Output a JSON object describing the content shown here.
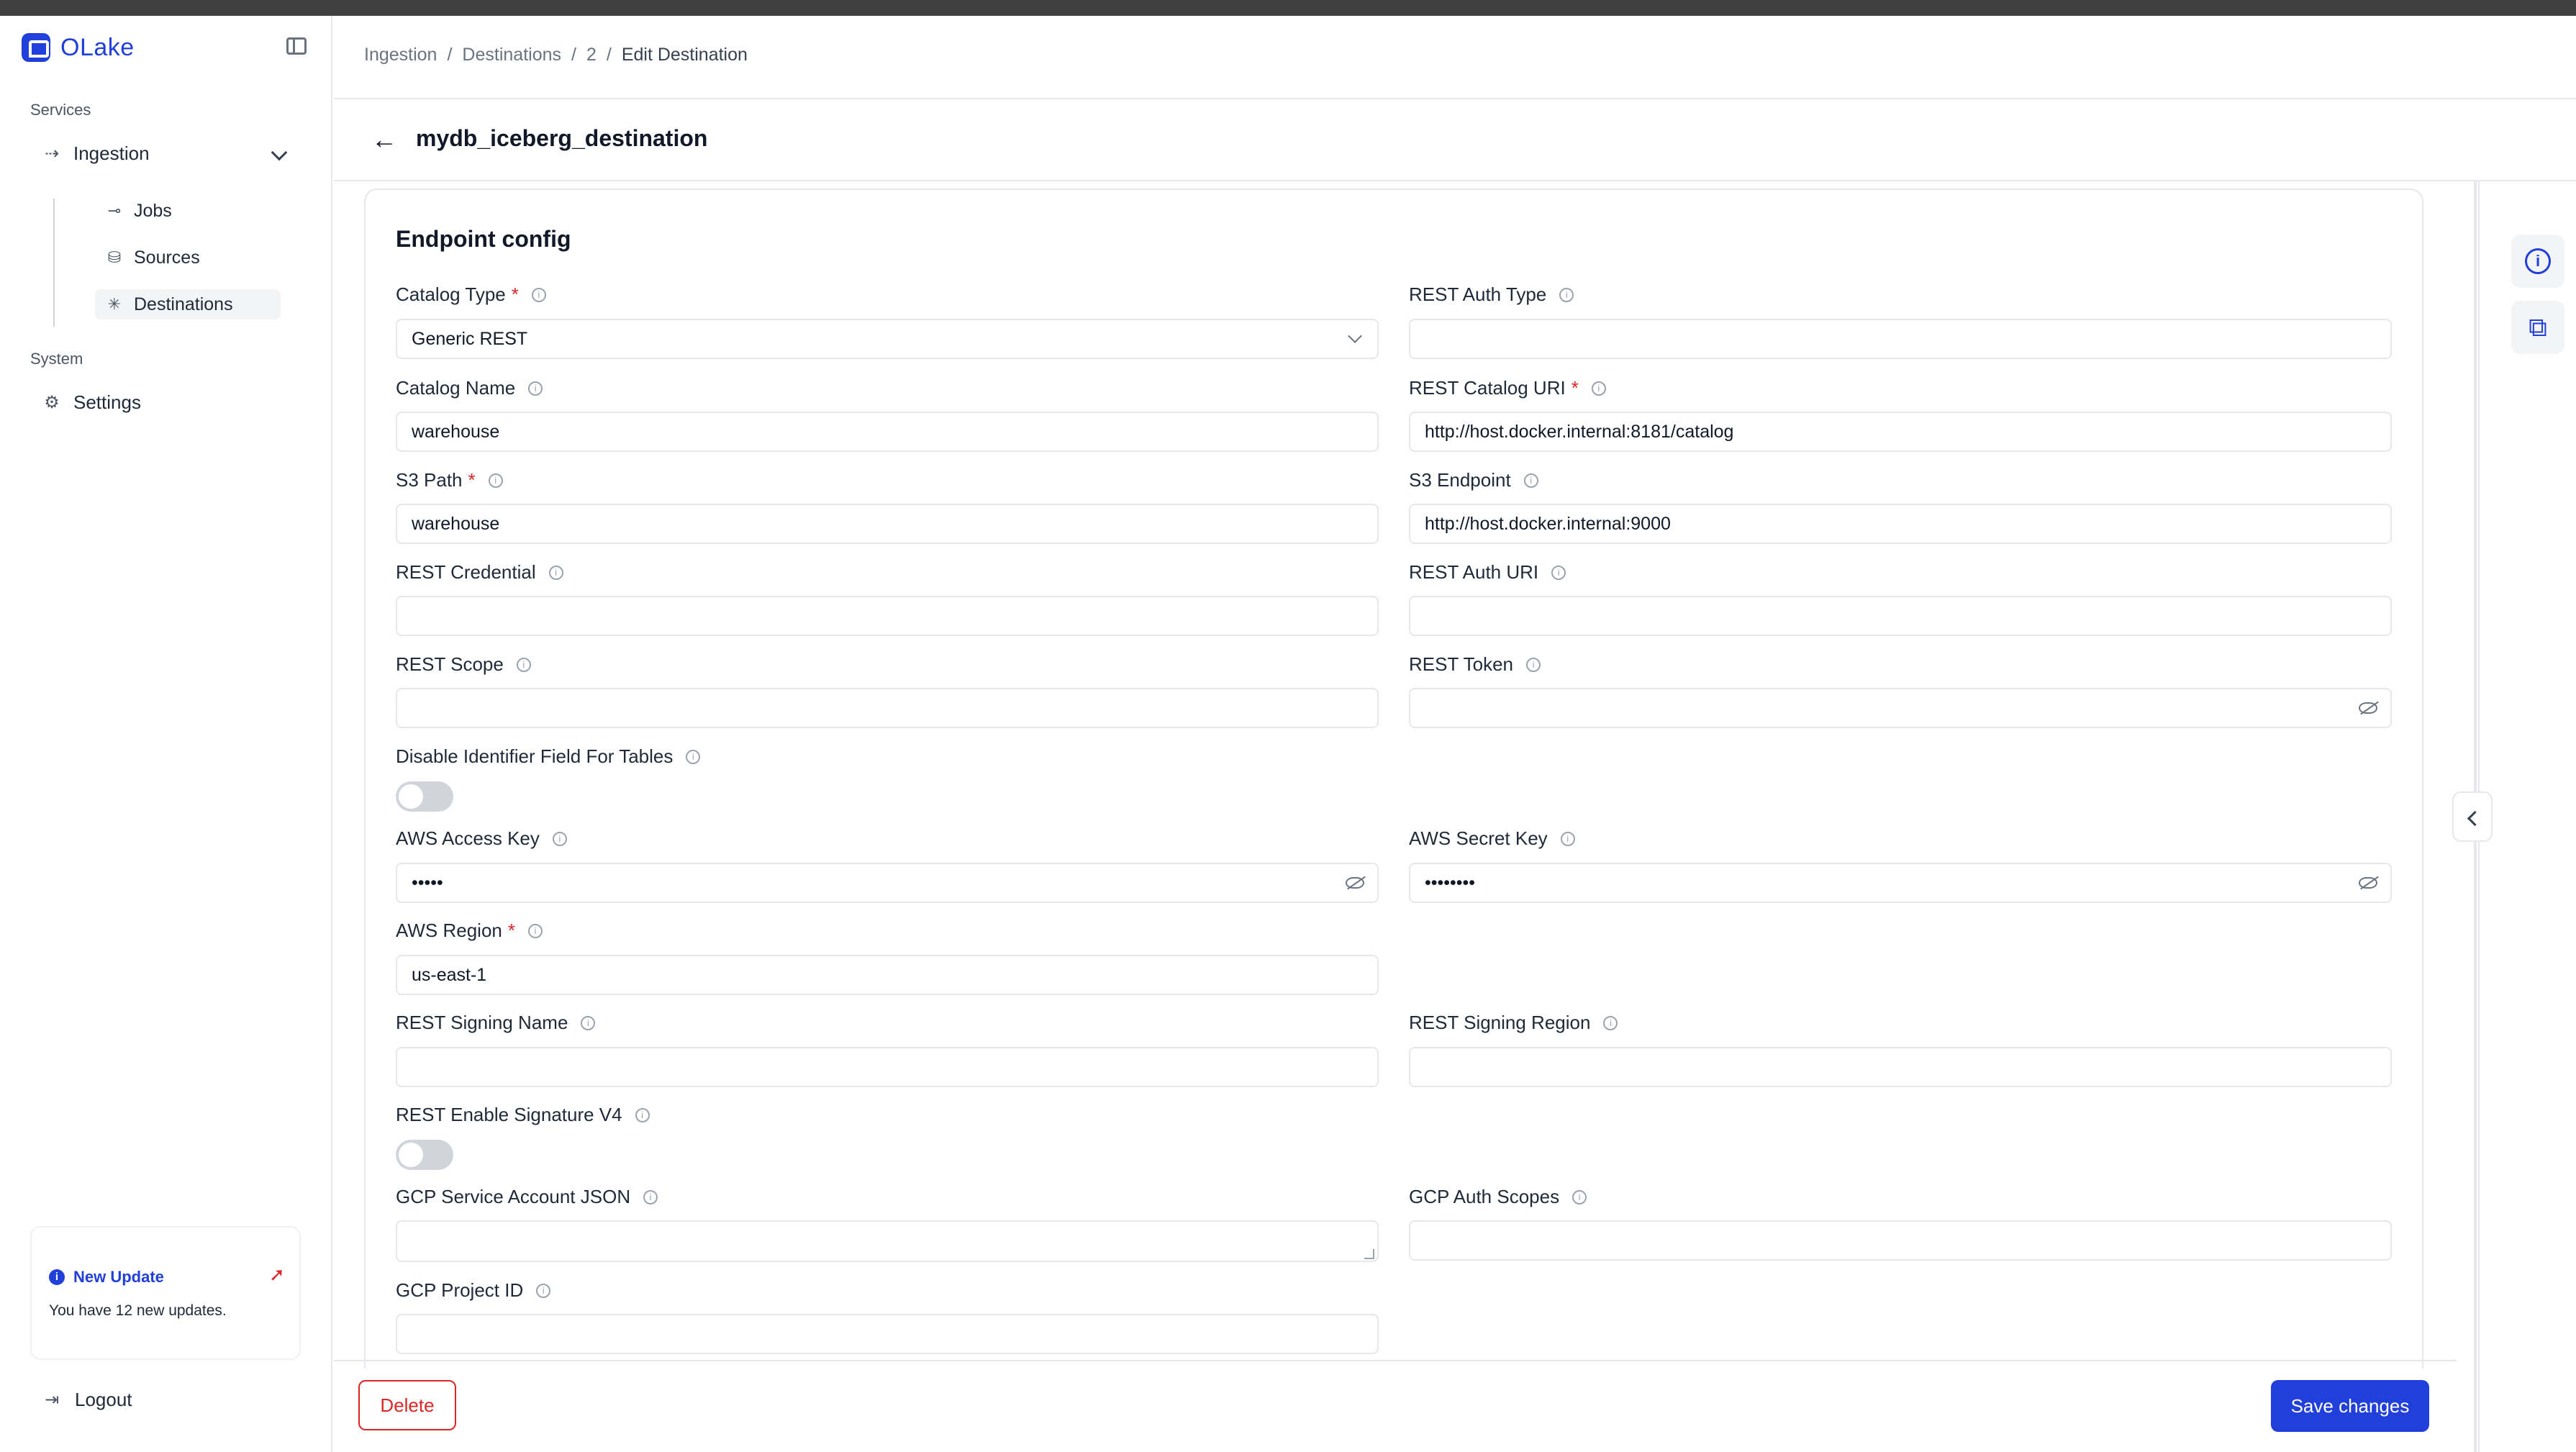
{
  "app": {
    "name": "OLake"
  },
  "sidebar": {
    "services_label": "Services",
    "ingestion_label": "Ingestion",
    "sub_items": [
      {
        "label": "Jobs",
        "icon": "jobs-icon"
      },
      {
        "label": "Sources",
        "icon": "sources-icon"
      },
      {
        "label": "Destinations",
        "icon": "destinations-icon"
      }
    ],
    "system_label": "System",
    "settings_label": "Settings",
    "update": {
      "title": "New Update",
      "text": "You have 12 new updates."
    },
    "logout_label": "Logout"
  },
  "breadcrumb": [
    "Ingestion",
    "Destinations",
    "2",
    "Edit Destination"
  ],
  "page": {
    "title": "mydb_iceberg_destination"
  },
  "form": {
    "section_title": "Endpoint config",
    "catalog_type": {
      "label": "Catalog Type",
      "value": "Generic REST"
    },
    "rest_auth_type": {
      "label": "REST Auth Type",
      "value": ""
    },
    "catalog_name": {
      "label": "Catalog Name",
      "value": "warehouse"
    },
    "rest_catalog_uri": {
      "label": "REST Catalog URI",
      "value": "http://host.docker.internal:8181/catalog"
    },
    "s3_path": {
      "label": "S3 Path",
      "value": "warehouse"
    },
    "s3_endpoint": {
      "label": "S3 Endpoint",
      "value": "http://host.docker.internal:9000"
    },
    "rest_credential": {
      "label": "REST Credential",
      "value": ""
    },
    "rest_auth_uri": {
      "label": "REST Auth URI",
      "value": ""
    },
    "rest_scope": {
      "label": "REST Scope",
      "value": ""
    },
    "rest_token": {
      "label": "REST Token",
      "value": ""
    },
    "disable_identifier": {
      "label": "Disable Identifier Field For Tables",
      "on": false
    },
    "aws_access_key": {
      "label": "AWS Access Key",
      "value": "•••••"
    },
    "aws_secret_key": {
      "label": "AWS Secret Key",
      "value": "••••••••"
    },
    "aws_region": {
      "label": "AWS Region",
      "value": "us-east-1"
    },
    "rest_signing_name": {
      "label": "REST Signing Name",
      "value": ""
    },
    "rest_signing_region": {
      "label": "REST Signing Region",
      "value": ""
    },
    "rest_enable_sigv4": {
      "label": "REST Enable Signature V4",
      "on": false
    },
    "gcp_service_account": {
      "label": "GCP Service Account JSON",
      "value": ""
    },
    "gcp_auth_scopes": {
      "label": "GCP Auth Scopes",
      "value": ""
    },
    "gcp_project_id": {
      "label": "GCP Project ID",
      "value": ""
    }
  },
  "actions": {
    "delete_label": "Delete",
    "save_label": "Save changes"
  },
  "colors": {
    "primary": "#203fdb",
    "danger": "#dc2626",
    "border": "#e5e7eb"
  }
}
